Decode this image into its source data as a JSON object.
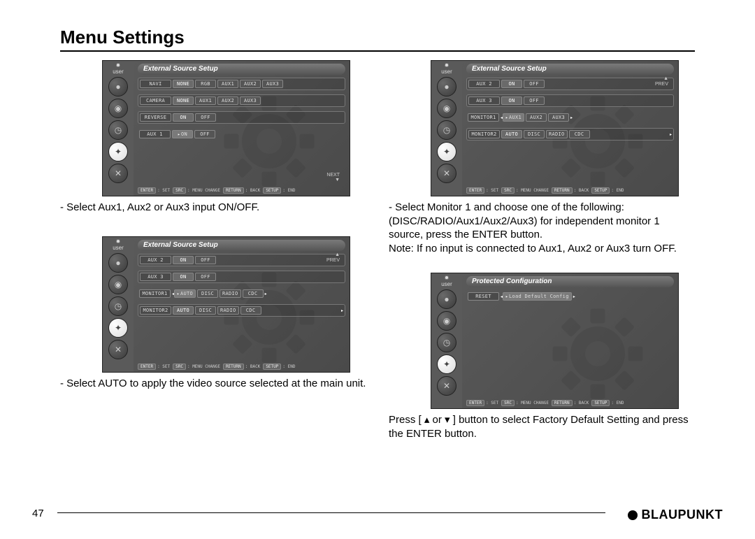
{
  "page": {
    "title": "Menu Settings",
    "number": "47",
    "brand": "BLAUPUNKT"
  },
  "screens": {
    "s1": {
      "title": "External Source Setup",
      "rows": [
        {
          "label": "NAVI",
          "opts": [
            "NONE",
            "RGB",
            "AUX1",
            "AUX2",
            "AUX3"
          ],
          "sel": 0
        },
        {
          "label": "CAMERA",
          "opts": [
            "NONE",
            "AUX1",
            "AUX2",
            "AUX3"
          ],
          "sel": 0
        },
        {
          "label": "REVERSE",
          "opts": [
            "ON",
            "OFF"
          ],
          "sel": 0
        },
        {
          "label": "AUX 1",
          "opts": [
            "ON",
            "OFF"
          ],
          "sel": 0,
          "hl": true
        }
      ],
      "navhint": "NEXT\n▼",
      "footer": [
        [
          "ENTER",
          "SET"
        ],
        [
          "SRC",
          "MENU CHANGE"
        ],
        [
          "RETURN",
          "BACK"
        ],
        [
          "SETUP",
          "END"
        ]
      ]
    },
    "s2": {
      "title": "External Source Setup",
      "rows": [
        {
          "label": "AUX 2",
          "opts": [
            "ON",
            "OFF"
          ],
          "sel": 0
        },
        {
          "label": "AUX 3",
          "opts": [
            "ON",
            "OFF"
          ],
          "sel": 0
        },
        {
          "label": "MONITOR1",
          "opts": [
            "AUTO",
            "DISC",
            "RADIO",
            "CDC"
          ],
          "sel": 0,
          "hl": true,
          "arrows": true
        },
        {
          "label": "MONITOR2",
          "opts": [
            "AUTO",
            "DISC",
            "RADIO",
            "CDC"
          ],
          "sel": 0,
          "arrows_r": true
        }
      ],
      "navhint": "▲\nPREV",
      "footer": [
        [
          "ENTER",
          "SET"
        ],
        [
          "SRC",
          "MENU CHANGE"
        ],
        [
          "RETURN",
          "BACK"
        ],
        [
          "SETUP",
          "END"
        ]
      ]
    },
    "s3": {
      "title": "External Source Setup",
      "rows": [
        {
          "label": "AUX 2",
          "opts": [
            "ON",
            "OFF"
          ],
          "sel": 0
        },
        {
          "label": "AUX 3",
          "opts": [
            "ON",
            "OFF"
          ],
          "sel": 0
        },
        {
          "label": "MONITOR1",
          "opts": [
            "AUX1",
            "AUX2",
            "AUX3"
          ],
          "sel": 0,
          "hl": true,
          "arrows": true
        },
        {
          "label": "MONITOR2",
          "opts": [
            "AUTO",
            "DISC",
            "RADIO",
            "CDC"
          ],
          "sel": 0,
          "arrows_r": true
        }
      ],
      "navhint": "▲\nPREV",
      "footer": [
        [
          "ENTER",
          "SET"
        ],
        [
          "SRC",
          "MENU CHANGE"
        ],
        [
          "RETURN",
          "BACK"
        ],
        [
          "SETUP",
          "END"
        ]
      ]
    },
    "s4": {
      "title": "Protected Configuration",
      "rows": [
        {
          "label": "RESET",
          "opts": [
            "Load Default Config"
          ],
          "sel": 0,
          "hl": true,
          "arrows": true
        }
      ],
      "footer": [
        [
          "ENTER",
          "SET"
        ],
        [
          "SRC",
          "MENU CHANGE"
        ],
        [
          "RETURN",
          "BACK"
        ],
        [
          "SETUP",
          "END"
        ]
      ]
    }
  },
  "captions": {
    "c1": "- Select Aux1, Aux2 or Aux3 input ON/OFF.",
    "c2": "- Select AUTO to apply the video source selected at the main unit.",
    "c3": "- Select Monitor 1 and choose one of the following: (DISC/RADIO/Aux1/Aux2/Aux3) for independent monitor 1 source, press the ENTER button.\nNote: If no input is connected to Aux1, Aux2 or Aux3 turn OFF.",
    "c4": "Press [ ▴ or ▾ ] button to select Factory Default Setting and press the ENTER button."
  },
  "sidebar_icons": [
    "user",
    "disc",
    "tuner",
    "clock",
    "compass",
    "tools"
  ]
}
